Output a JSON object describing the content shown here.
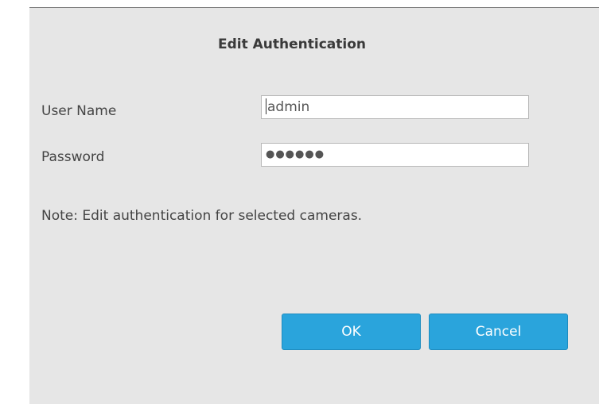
{
  "dialog": {
    "title": "Edit Authentication",
    "user_name_label": "User Name",
    "user_name_value": "admin",
    "password_label": "Password",
    "password_value": "●●●●●●",
    "note": "Note: Edit authentication for selected cameras.",
    "ok_label": "OK",
    "cancel_label": "Cancel"
  },
  "colors": {
    "dialog_bg": "#e6e6e6",
    "button_bg": "#2aa4dc"
  }
}
